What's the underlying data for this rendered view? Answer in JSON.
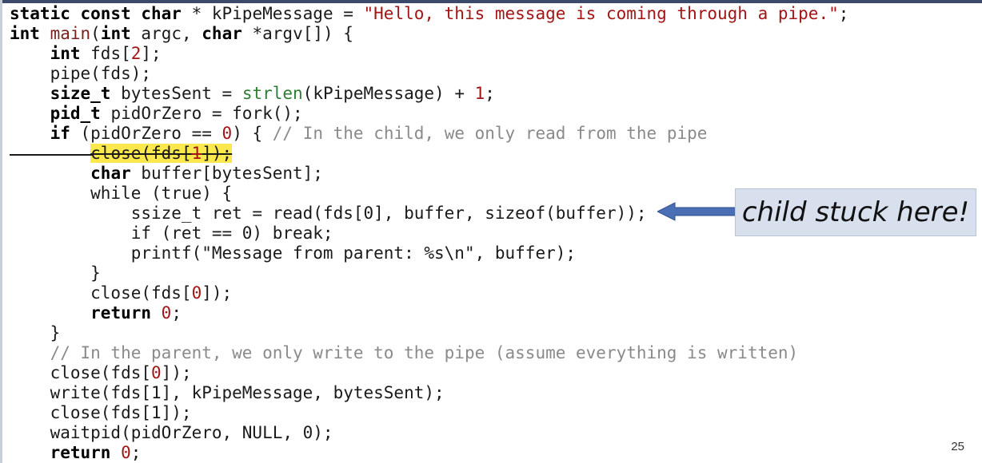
{
  "code": {
    "lines": [
      [
        {
          "t": "static const char",
          "c": "kw"
        },
        {
          "t": " * kPipeMessage = ",
          "c": "plain"
        },
        {
          "t": "\"Hello, this message is coming through a pipe.\"",
          "c": "str"
        },
        {
          "t": ";",
          "c": "plain"
        }
      ],
      [
        {
          "t": "int",
          "c": "kw"
        },
        {
          "t": " ",
          "c": "plain"
        },
        {
          "t": "main",
          "c": "fn"
        },
        {
          "t": "(",
          "c": "plain"
        },
        {
          "t": "int",
          "c": "kw"
        },
        {
          "t": " argc, ",
          "c": "plain"
        },
        {
          "t": "char",
          "c": "kw"
        },
        {
          "t": " *argv[]) {",
          "c": "plain"
        }
      ],
      [
        {
          "t": "    ",
          "c": "plain"
        },
        {
          "t": "int",
          "c": "kw"
        },
        {
          "t": " fds[",
          "c": "plain"
        },
        {
          "t": "2",
          "c": "num"
        },
        {
          "t": "];",
          "c": "plain"
        }
      ],
      [
        {
          "t": "    pipe(fds);",
          "c": "plain"
        }
      ],
      [
        {
          "t": "    ",
          "c": "plain"
        },
        {
          "t": "size_t",
          "c": "kw"
        },
        {
          "t": " bytesSent = ",
          "c": "plain"
        },
        {
          "t": "strlen",
          "c": "call"
        },
        {
          "t": "(kPipeMessage) + ",
          "c": "plain"
        },
        {
          "t": "1",
          "c": "num"
        },
        {
          "t": ";",
          "c": "plain"
        }
      ],
      [
        {
          "t": "    ",
          "c": "plain"
        },
        {
          "t": "pid_t",
          "c": "kw"
        },
        {
          "t": " pidOrZero = fork();",
          "c": "plain"
        }
      ],
      [
        {
          "t": "    ",
          "c": "plain"
        },
        {
          "t": "if",
          "c": "kw"
        },
        {
          "t": " (pidOrZero == ",
          "c": "plain"
        },
        {
          "t": "0",
          "c": "num"
        },
        {
          "t": ") { ",
          "c": "plain"
        },
        {
          "t": "// In the child, we only read from the pipe",
          "c": "cmt"
        }
      ],
      [
        {
          "t": "        ",
          "c": "plain"
        },
        {
          "t": "close(fds[",
          "c": "struck"
        },
        {
          "t": "1",
          "c": "struck-num"
        },
        {
          "t": "]);",
          "c": "struck"
        }
      ],
      [
        {
          "t": "        ",
          "c": "plain"
        },
        {
          "t": "char",
          "c": "kw"
        },
        {
          "t": " buffer[bytesSent];",
          "c": "plain"
        }
      ],
      [
        {
          "t": "        while (true) {",
          "c": "plain"
        }
      ],
      [
        {
          "t": "            ssize_t ret = read(fds[0], buffer, sizeof(buffer));",
          "c": "plain"
        }
      ],
      [
        {
          "t": "            if (ret == 0) break;",
          "c": "plain"
        }
      ],
      [
        {
          "t": "            printf(\"Message from parent: %s\\n\", buffer);",
          "c": "plain"
        }
      ],
      [
        {
          "t": "        }",
          "c": "plain"
        }
      ],
      [
        {
          "t": "        close(fds[",
          "c": "plain"
        },
        {
          "t": "0",
          "c": "num"
        },
        {
          "t": "]);",
          "c": "plain"
        }
      ],
      [
        {
          "t": "        ",
          "c": "plain"
        },
        {
          "t": "return",
          "c": "kw"
        },
        {
          "t": " ",
          "c": "plain"
        },
        {
          "t": "0",
          "c": "num"
        },
        {
          "t": ";",
          "c": "plain"
        }
      ],
      [
        {
          "t": "    }",
          "c": "plain"
        }
      ],
      [
        {
          "t": "    ",
          "c": "plain"
        },
        {
          "t": "// In the parent, we only write to the pipe (assume everything is written)",
          "c": "cmt"
        }
      ],
      [
        {
          "t": "    close(fds[",
          "c": "plain"
        },
        {
          "t": "0",
          "c": "num"
        },
        {
          "t": "]);",
          "c": "plain"
        }
      ],
      [
        {
          "t": "    write(fds[1], kPipeMessage, bytesSent);",
          "c": "plain"
        }
      ],
      [
        {
          "t": "    close(fds[1]);",
          "c": "plain"
        }
      ],
      [
        {
          "t": "    waitpid(pidOrZero, NULL, 0);",
          "c": "plain"
        }
      ],
      [
        {
          "t": "    ",
          "c": "plain"
        },
        {
          "t": "return",
          "c": "kw"
        },
        {
          "t": " ",
          "c": "plain"
        },
        {
          "t": "0",
          "c": "num"
        },
        {
          "t": ";",
          "c": "plain"
        }
      ]
    ]
  },
  "callout": {
    "text": "child stuck here!",
    "box_color": "#d8e0ee",
    "arrow_color": "#4a6fb5"
  },
  "highlight": {
    "color": "#fbe84d"
  },
  "footer": {
    "slide_number": "25"
  }
}
